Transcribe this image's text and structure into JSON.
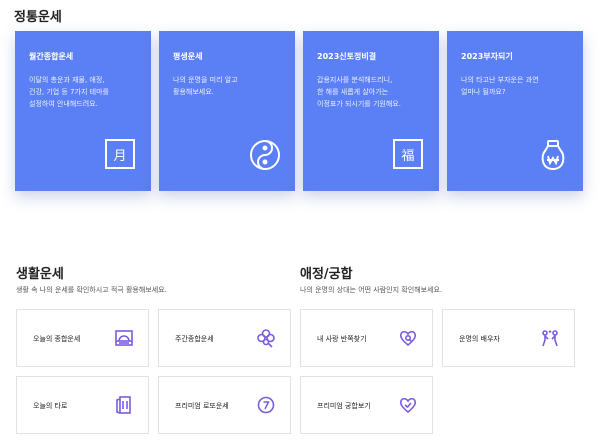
{
  "fortune_section": {
    "title": "정통운세",
    "cards": [
      {
        "title": "월간종합운세",
        "desc": "이달의 총운과 재물, 애정,\n건강, 기업 등 7가지 테마를\n설정하여 안내해드려요.",
        "icon": "moon-calendar-icon",
        "glyph": "月"
      },
      {
        "title": "평생운세",
        "desc": "나의 운명을 미리 알고\n활용해보세요.",
        "icon": "yin-yang-icon"
      },
      {
        "title": "2023신토정비결",
        "desc": "갑용지사를 분석해드리니,\n한 해를 새롭게 살아가는\n이정표가 되시기를 기원해요.",
        "icon": "fortune-blessing-icon",
        "glyph": "福"
      },
      {
        "title": "2023부자되기",
        "desc": "나의 타고난 부자운은 과연\n얼마나 될까요?",
        "icon": "money-bag-icon"
      }
    ]
  },
  "life_section": {
    "title": "생활운세",
    "desc": "생활 속 나의 운세를 확인하시고 적극 활용해보세요.",
    "tiles": [
      {
        "label": "오늘의 종합운세",
        "icon": "sunrise-icon"
      },
      {
        "label": "주간종합운세",
        "icon": "clover-icon"
      },
      {
        "label": "오늘의 타로",
        "icon": "tarot-cards-icon"
      },
      {
        "label": "프리미엄 로또운세",
        "icon": "lotto-ball-icon"
      }
    ]
  },
  "love_section": {
    "title": "애정/궁합",
    "desc": "나의 운명의 상대는 어떤 사람인지 확인해보세요.",
    "tiles": [
      {
        "label": "내 사랑 반쪽찾기",
        "icon": "heart-search-icon"
      },
      {
        "label": "운명의 배우자",
        "icon": "couple-icon"
      },
      {
        "label": "프리미엄 궁합보기",
        "icon": "heart-check-icon"
      }
    ]
  },
  "colors": {
    "card_blue": "#5b7ff4",
    "accent_purple": "#7b5ce0"
  }
}
